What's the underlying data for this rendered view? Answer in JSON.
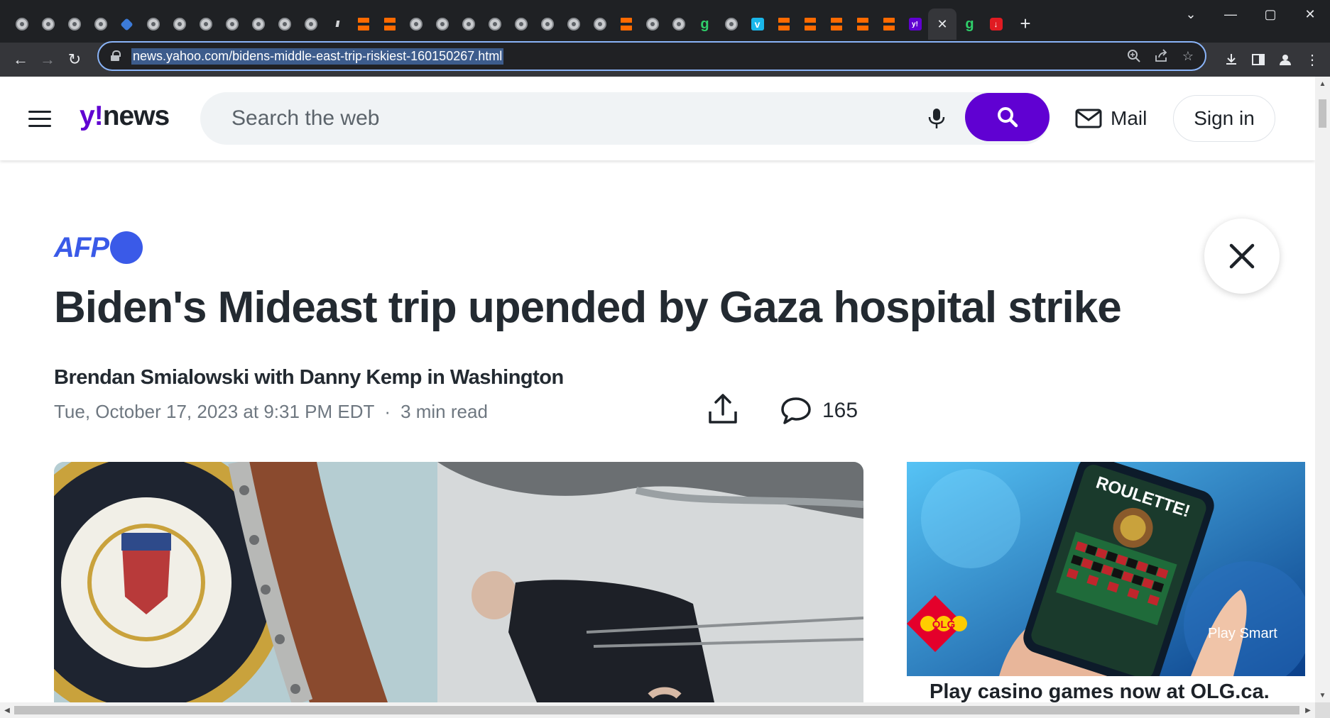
{
  "browser": {
    "url": "news.yahoo.com/bidens-middle-east-trip-riskiest-160150267.html",
    "tabs": [
      {
        "icon": "globe-icon"
      },
      {
        "icon": "globe-icon"
      },
      {
        "icon": "globe-icon"
      },
      {
        "icon": "globe-icon"
      },
      {
        "icon": "blue-diamond-icon"
      },
      {
        "icon": "globe-icon"
      },
      {
        "icon": "globe-icon"
      },
      {
        "icon": "globe-icon"
      },
      {
        "icon": "globe-icon"
      },
      {
        "icon": "globe-icon"
      },
      {
        "icon": "globe-icon"
      },
      {
        "icon": "globe-icon"
      },
      {
        "icon": "slash-logo-icon"
      },
      {
        "icon": "bookmark-icon"
      },
      {
        "icon": "bookmark-icon"
      },
      {
        "icon": "globe-icon"
      },
      {
        "icon": "globe-icon"
      },
      {
        "icon": "globe-icon"
      },
      {
        "icon": "globe-icon"
      },
      {
        "icon": "globe-icon"
      },
      {
        "icon": "globe-icon"
      },
      {
        "icon": "globe-icon"
      },
      {
        "icon": "globe-icon"
      },
      {
        "icon": "bookmark-icon"
      },
      {
        "icon": "globe-icon"
      },
      {
        "icon": "globe-icon"
      },
      {
        "icon": "green-g-icon"
      },
      {
        "icon": "globe-icon"
      },
      {
        "icon": "vimeo-icon"
      },
      {
        "icon": "bookmark-icon"
      },
      {
        "icon": "bookmark-icon"
      },
      {
        "icon": "bookmark-icon"
      },
      {
        "icon": "bookmark-icon"
      },
      {
        "icon": "bookmark-icon"
      },
      {
        "icon": "yahoo-icon"
      },
      {
        "icon": "close-icon",
        "active": true
      },
      {
        "icon": "green-g-icon"
      },
      {
        "icon": "red-pin-icon"
      }
    ]
  },
  "header": {
    "logo": {
      "y": "y!",
      "news": "news"
    },
    "search_placeholder": "Search the web",
    "mail_label": "Mail",
    "signin_label": "Sign in",
    "brand_color": "#6001d2"
  },
  "article": {
    "source": "AFP",
    "headline": "Biden's Mideast trip upended by Gaza hospital strike",
    "byline": "Brendan Smialowski with Danny Kemp in Washington",
    "date": "Tue, October 17, 2023 at 9:31 PM EDT",
    "separator": "·",
    "read_time": "3 min read",
    "comment_count": "165"
  },
  "ad": {
    "headline": "Play casino games now at OLG.ca.",
    "phone_text": "ROULETTE!",
    "brand": "OLG",
    "tagline": "Play Smart"
  }
}
